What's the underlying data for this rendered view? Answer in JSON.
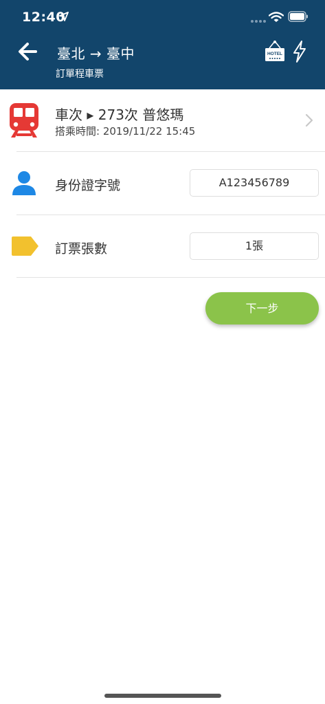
{
  "status_bar": {
    "time": "12:40"
  },
  "header": {
    "route": "臺北 → 臺中",
    "subtitle": "訂單程車票",
    "hotel_sign_text": "HOTEL",
    "icons": [
      "back-arrow-icon",
      "hotel-sign-icon",
      "lightning-bolt-icon"
    ]
  },
  "train": {
    "title": "車次 ▸ 273次 普悠瑪",
    "time_label": "搭乘時間:",
    "time_value": "2019/11/22 15:45"
  },
  "form": {
    "id_label": "身份證字號",
    "id_value": "A123456789",
    "tickets_label": "訂票張數",
    "tickets_value": "1張"
  },
  "actions": {
    "next_label": "下一步"
  },
  "colors": {
    "header_bg": "#12456b",
    "train_icon": "#e53935",
    "person_icon": "#1e88e5",
    "tag_icon": "#f2c12e",
    "next_button": "#8bc34a"
  }
}
